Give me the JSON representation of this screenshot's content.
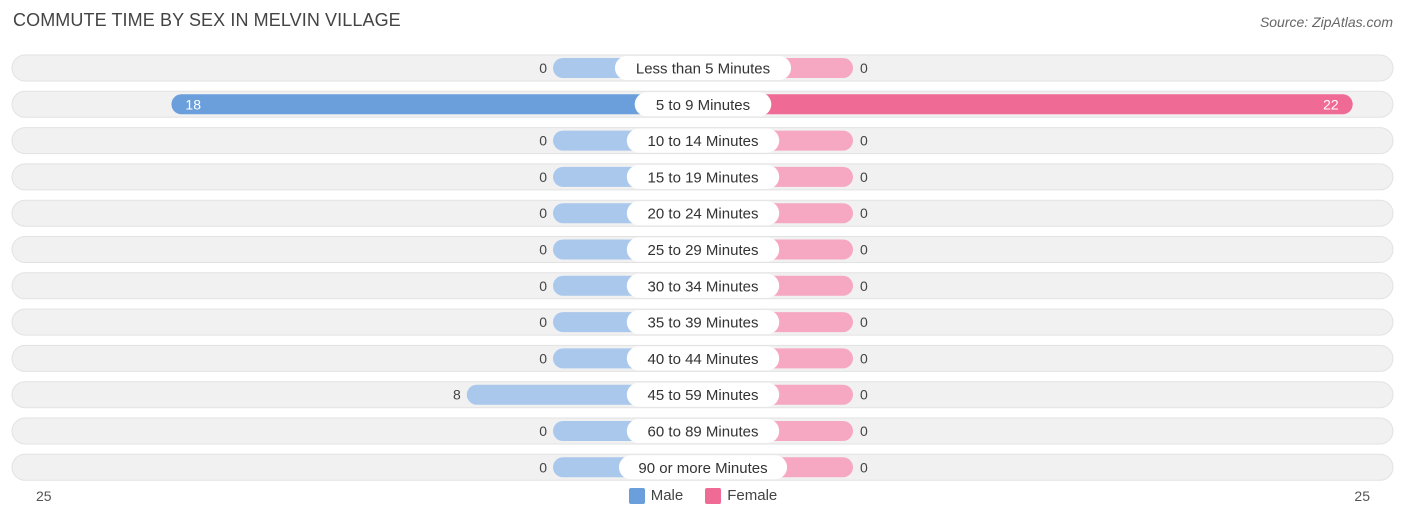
{
  "header": {
    "title": "COMMUTE TIME BY SEX IN MELVIN VILLAGE",
    "source": "Source: ZipAtlas.com"
  },
  "colors": {
    "male_strong": "#6a9fdc",
    "male_light": "#a9c8ec",
    "female_strong": "#f06a96",
    "female_light": "#f6a8c2",
    "row_bg": "#f1f1f1",
    "row_border": "#e2e2e2"
  },
  "chart_data": {
    "type": "bar",
    "orientation": "horizontal-diverging",
    "title": "COMMUTE TIME BY SEX IN MELVIN VILLAGE",
    "categories": [
      "Less than 5 Minutes",
      "5 to 9 Minutes",
      "10 to 14 Minutes",
      "15 to 19 Minutes",
      "20 to 24 Minutes",
      "25 to 29 Minutes",
      "30 to 34 Minutes",
      "35 to 39 Minutes",
      "40 to 44 Minutes",
      "45 to 59 Minutes",
      "60 to 89 Minutes",
      "90 or more Minutes"
    ],
    "series": [
      {
        "name": "Male",
        "side": "left",
        "values": [
          0,
          18,
          0,
          0,
          0,
          0,
          0,
          0,
          0,
          8,
          0,
          0
        ]
      },
      {
        "name": "Female",
        "side": "right",
        "values": [
          0,
          22,
          0,
          0,
          0,
          0,
          0,
          0,
          0,
          0,
          0,
          0
        ]
      }
    ],
    "axis": {
      "left_max_label": "25",
      "right_max_label": "25",
      "range": [
        -25,
        25
      ]
    },
    "legend": {
      "position": "bottom-center",
      "entries": [
        "Male",
        "Female"
      ]
    },
    "grid": false
  }
}
